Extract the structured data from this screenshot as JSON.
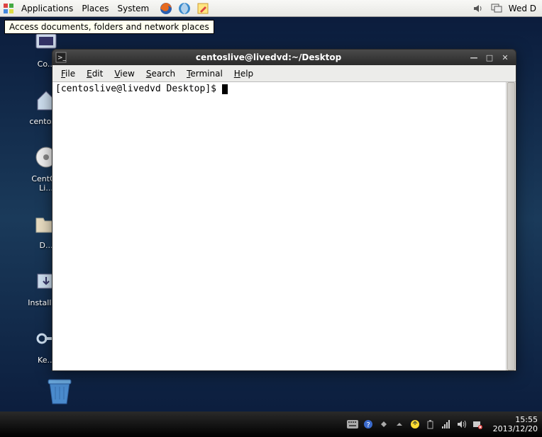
{
  "top_panel": {
    "menus": [
      "Applications",
      "Places",
      "System"
    ],
    "clock": "Wed D"
  },
  "tooltip": "Access documents, folders and network places",
  "desktop_icons": [
    {
      "label": "Co..."
    },
    {
      "label": "centos..."
    },
    {
      "label": "CentOS\nLi..."
    },
    {
      "label": "D..."
    },
    {
      "label": "Install t..."
    },
    {
      "label": "Ke..."
    }
  ],
  "terminal": {
    "title": "centoslive@livedvd:~/Desktop",
    "menubar": [
      {
        "u": "F",
        "rest": "ile"
      },
      {
        "u": "E",
        "rest": "dit"
      },
      {
        "u": "V",
        "rest": "iew"
      },
      {
        "u": "S",
        "rest": "earch"
      },
      {
        "u": "T",
        "rest": "erminal"
      },
      {
        "u": "H",
        "rest": "elp"
      }
    ],
    "prompt": "[centoslive@livedvd Desktop]$ "
  },
  "bottom_panel": {
    "time": "15:55",
    "date": "2013/12/20"
  }
}
